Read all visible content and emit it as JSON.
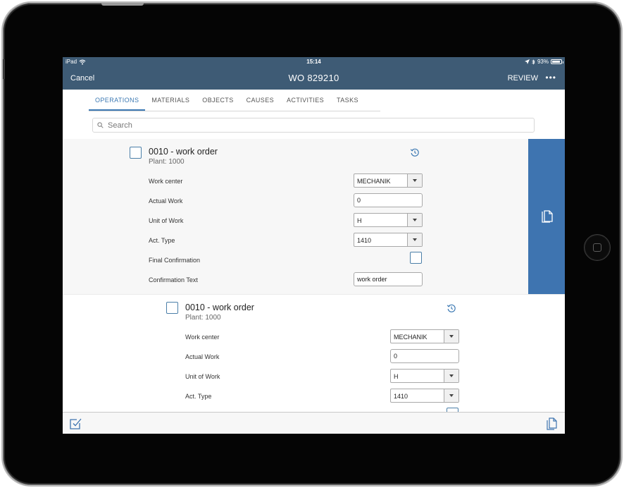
{
  "status_bar": {
    "device": "iPad",
    "time": "15:14",
    "battery": "93%",
    "battery_level": 0.93
  },
  "nav": {
    "cancel": "Cancel",
    "title": "WO 829210",
    "review": "REVIEW",
    "more": "•••"
  },
  "tabs": [
    {
      "label": "OPERATIONS",
      "active": true
    },
    {
      "label": "MATERIALS"
    },
    {
      "label": "OBJECTS"
    },
    {
      "label": "CAUSES"
    },
    {
      "label": "ACTIVITIES"
    },
    {
      "label": "TASKS"
    }
  ],
  "search": {
    "placeholder": "Search",
    "value": ""
  },
  "operations": [
    {
      "title": "0010 - work order",
      "plant": "Plant: 1000",
      "labels": {
        "work_center": "Work center",
        "actual_work": "Actual Work",
        "unit_of_work": "Unit of Work",
        "act_type": "Act. Type",
        "final_confirmation": "Final Confirmation",
        "confirmation_text": "Confirmation Text"
      },
      "values": {
        "work_center": "MECHANIK",
        "actual_work": "0",
        "unit_of_work": "H",
        "act_type": "1410",
        "confirmation_text": "work order"
      }
    },
    {
      "title": "0010 - work order",
      "plant": "Plant: 1000",
      "labels": {
        "work_center": "Work center",
        "actual_work": "Actual Work",
        "unit_of_work": "Unit of Work",
        "act_type": "Act. Type"
      },
      "values": {
        "work_center": "MECHANIK",
        "actual_work": "0",
        "unit_of_work": "H",
        "act_type": "1410"
      }
    }
  ],
  "icons": {
    "wifi": "wifi-icon",
    "location": "location-arrow-icon",
    "bluetooth": "bluetooth-icon",
    "search": "search-icon",
    "history": "history-icon",
    "copy": "copy-icon",
    "checkmark": "check-square-icon"
  },
  "colors": {
    "nav_bg": "#3e5b75",
    "accent": "#3c79b3",
    "side_panel": "#3e74b0"
  }
}
